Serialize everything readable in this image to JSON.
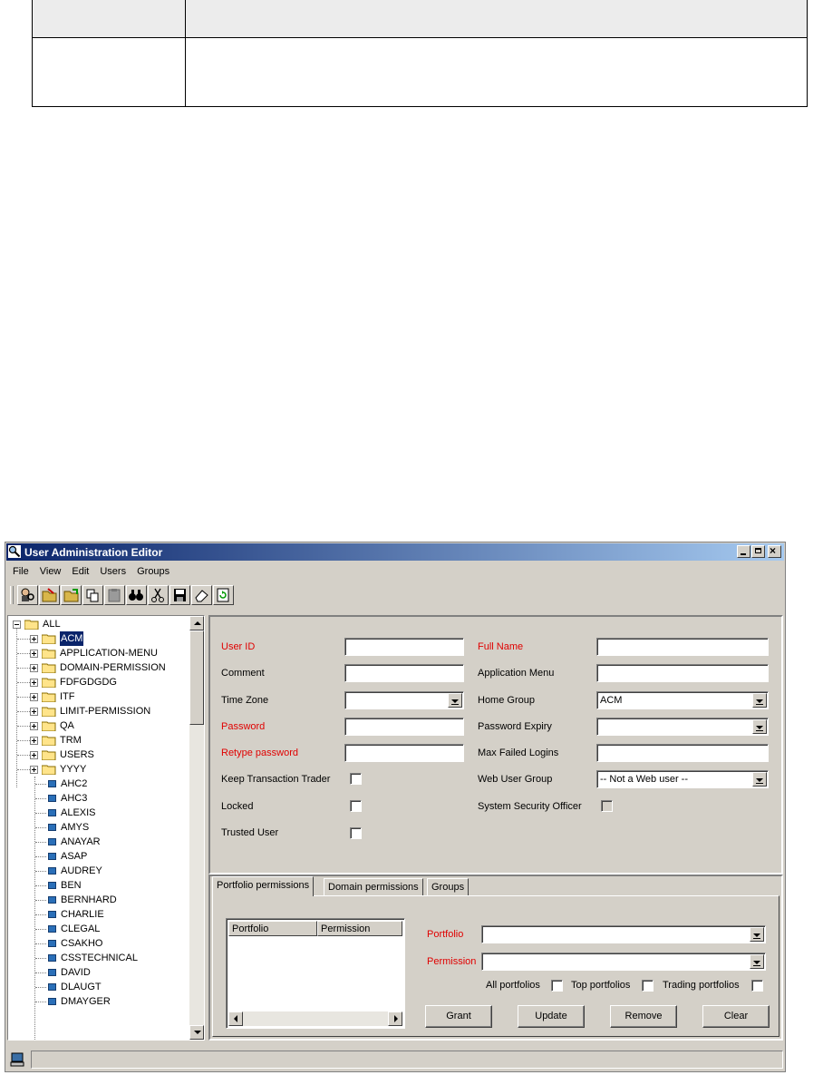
{
  "window": {
    "title": "User Administration Editor"
  },
  "menu": [
    "File",
    "View",
    "Edit",
    "Users",
    "Groups"
  ],
  "toolbar": [
    "find-user-icon",
    "close-folder-icon",
    "open-folder-icon",
    "copy-icon",
    "paste-icon",
    "binoculars-icon",
    "cut-icon",
    "save-icon",
    "eraser-icon",
    "refresh-icon"
  ],
  "tree": {
    "root": "ALL",
    "groups": [
      "ACM",
      "APPLICATION-MENU",
      "DOMAIN-PERMISSION",
      "FDFGDGDG",
      "ITF",
      "LIMIT-PERMISSION",
      "QA",
      "TRM",
      "USERS",
      "YYYY"
    ],
    "selected": "ACM",
    "users": [
      "AHC2",
      "AHC3",
      "ALEXIS",
      "AMYS",
      "ANAYAR",
      "ASAP",
      "AUDREY",
      "BEN",
      "BERNHARD",
      "CHARLIE",
      "CLEGAL",
      "CSAKHO",
      "CSSTECHNICAL",
      "DAVID",
      "DLAUGT",
      "DMAYGER"
    ]
  },
  "form": {
    "user_id": {
      "label": "User ID",
      "value": ""
    },
    "comment": {
      "label": "Comment",
      "value": ""
    },
    "time_zone": {
      "label": "Time Zone",
      "value": ""
    },
    "password": {
      "label": "Password",
      "value": ""
    },
    "retype_password": {
      "label": "Retype password",
      "value": ""
    },
    "keep_transaction_trader": {
      "label": "Keep Transaction Trader",
      "checked": false
    },
    "locked": {
      "label": "Locked",
      "checked": false
    },
    "trusted_user": {
      "label": "Trusted User",
      "checked": false
    },
    "full_name": {
      "label": "Full Name",
      "value": ""
    },
    "application_menu": {
      "label": "Application Menu",
      "value": ""
    },
    "home_group": {
      "label": "Home Group",
      "value": "ACM"
    },
    "password_expiry": {
      "label": "Password Expiry",
      "value": ""
    },
    "max_failed_logins": {
      "label": "Max Failed Logins",
      "value": ""
    },
    "web_user_group": {
      "label": "Web User Group",
      "value": "-- Not a Web user --"
    },
    "system_security_officer": {
      "label": "System Security Officer",
      "checked": false
    }
  },
  "tabs": [
    "Portfolio permissions",
    "Domain permissions",
    "Groups"
  ],
  "portfolio_tab": {
    "list_headers": [
      "Portfolio",
      "Permission"
    ],
    "portfolio_label": "Portfolio",
    "portfolio_value": "",
    "permission_label": "Permission",
    "permission_value": "",
    "all_portfolios": "All portfolios",
    "top_portfolios": "Top portfolios",
    "trading_portfolios": "Trading portfolios",
    "buttons": {
      "grant": "Grant",
      "update": "Update",
      "remove": "Remove",
      "clear": "Clear"
    }
  },
  "colors": {
    "required_label": "#e00000",
    "title_bar": "#0a246a",
    "selection": "#0a246a"
  }
}
